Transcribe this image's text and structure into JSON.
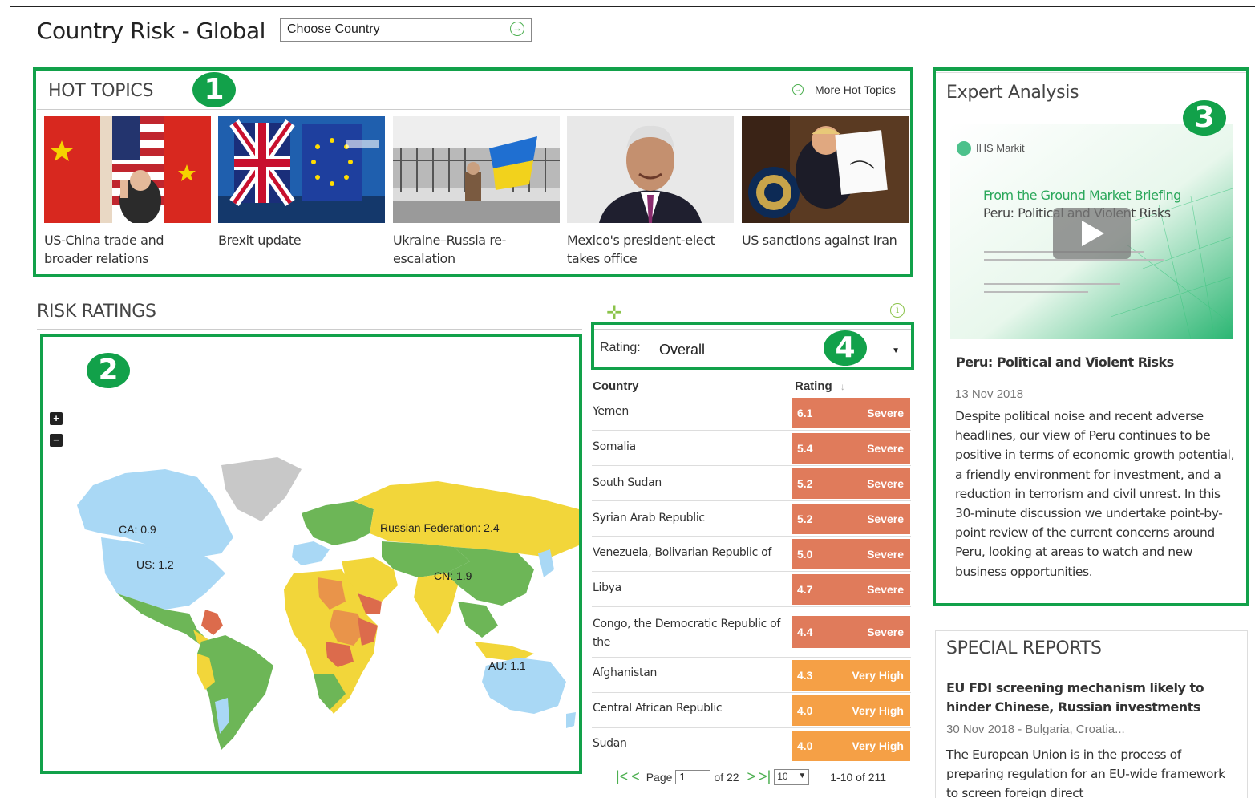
{
  "header": {
    "title": "Country Risk - Global",
    "country_select": "Choose Country"
  },
  "hot_topics": {
    "title": "HOT TOPICS",
    "more_link": "More Hot Topics",
    "items": [
      {
        "caption": "US-China trade and broader relations"
      },
      {
        "caption": "Brexit update"
      },
      {
        "caption": "Ukraine–Russia re-escalation"
      },
      {
        "caption": "Mexico's president-elect takes office"
      },
      {
        "caption": "US sanctions against Iran"
      }
    ]
  },
  "annotations": {
    "b1": "1",
    "b2": "2",
    "b3": "3",
    "b4": "4"
  },
  "risk_ratings": {
    "title": "RISK RATINGS",
    "zoom_in": "+",
    "zoom_out": "−",
    "map_labels": {
      "ca": "CA: 0.9",
      "us": "US: 1.2",
      "ru": "Russian Federation: 2.4",
      "cn": "CN: 1.9",
      "au": "AU: 1.1"
    },
    "rating_label": "Rating:",
    "rating_value": "Overall",
    "columns": {
      "country": "Country",
      "rating": "Rating"
    },
    "rows": [
      {
        "country": "Yemen",
        "score": "6.1",
        "level": "Severe"
      },
      {
        "country": "Somalia",
        "score": "5.4",
        "level": "Severe"
      },
      {
        "country": "South Sudan",
        "score": "5.2",
        "level": "Severe"
      },
      {
        "country": "Syrian Arab Republic",
        "score": "5.2",
        "level": "Severe"
      },
      {
        "country": "Venezuela, Bolivarian Republic of",
        "score": "5.0",
        "level": "Severe"
      },
      {
        "country": "Libya",
        "score": "4.7",
        "level": "Severe"
      },
      {
        "country": "Congo, the Democratic Republic of the",
        "score": "4.4",
        "level": "Severe"
      },
      {
        "country": "Afghanistan",
        "score": "4.3",
        "level": "Very High"
      },
      {
        "country": "Central African Republic",
        "score": "4.0",
        "level": "Very High"
      },
      {
        "country": "Sudan",
        "score": "4.0",
        "level": "Very High"
      }
    ],
    "pager": {
      "page_label": "Page",
      "page_value": "1",
      "of_label": "of 22",
      "per_page": "10",
      "range": "1-10 of 211"
    }
  },
  "expert": {
    "title": "Expert Analysis",
    "video": {
      "brand": "IHS Markit",
      "line1": "From the Ground Market Briefing",
      "line2": "Peru: Political and Violent Risks"
    },
    "article_title": "Peru: Political and Violent Risks",
    "date": "13 Nov 2018",
    "body": "Despite political noise and recent adverse headlines, our view of Peru continues to be positive in terms of economic growth potential, a friendly environment for investment, and a reduction in terrorism and civil unrest. In this 30-minute discussion we undertake point-by-point review of the current concerns around Peru, looking at areas to watch and new business opportunities."
  },
  "special_reports": {
    "title": "SPECIAL REPORTS",
    "headline": "EU FDI screening mechanism likely to hinder Chinese, Russian investments",
    "date": "30 Nov 2018",
    "tags": "Bulgaria, Croatia...",
    "body": "The European Union is in the process of preparing regulation for an EU-wide framework to screen foreign direct"
  },
  "colors": {
    "severe": "#e07b5b",
    "very_high": "#f5a046",
    "accent": "#12a14a"
  }
}
